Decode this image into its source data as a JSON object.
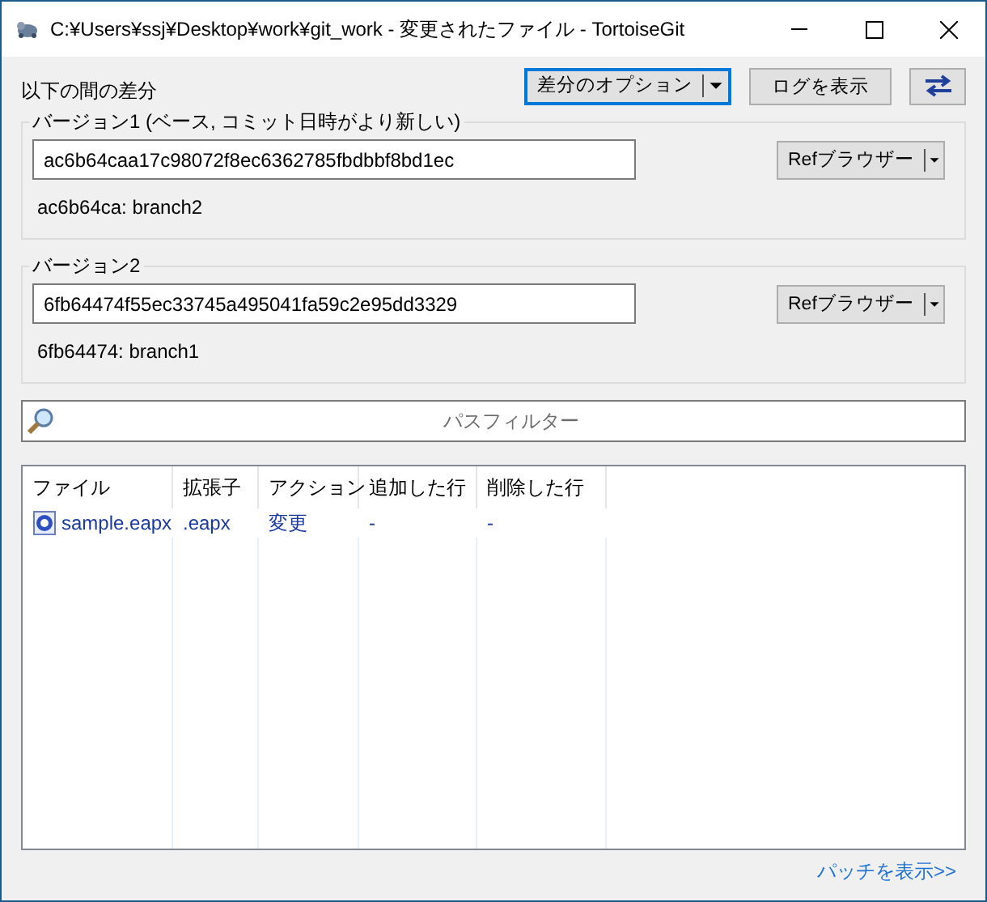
{
  "window": {
    "title": "C:¥Users¥ssj¥Desktop¥work¥git_work - 変更されたファイル - TortoiseGit"
  },
  "diff_label": "以下の間の差分",
  "toolbar": {
    "options_button": "差分のオプション",
    "log_button": "ログを表示"
  },
  "versions": [
    {
      "legend": "バージョン1 (ベース, コミット日時がより新しい)",
      "hash": "ac6b64caa17c98072f8ec6362785fbdbbf8bd1ec",
      "ref_button": "Refブラウザー",
      "info": "ac6b64ca: branch2"
    },
    {
      "legend": "バージョン2",
      "hash": "6fb64474f55ec33745a495041fa59c2e95dd3329",
      "ref_button": "Refブラウザー",
      "info": "6fb64474: branch1"
    }
  ],
  "path_filter": {
    "placeholder": "パスフィルター"
  },
  "file_list": {
    "columns": [
      "ファイル",
      "拡張子",
      "アクション",
      "追加した行",
      "削除した行"
    ],
    "rows": [
      {
        "cells": [
          "sample.eapx",
          ".eapx",
          "変更",
          "-",
          "-"
        ],
        "selected": false
      }
    ]
  },
  "patch_link": "パッチを表示>>"
}
